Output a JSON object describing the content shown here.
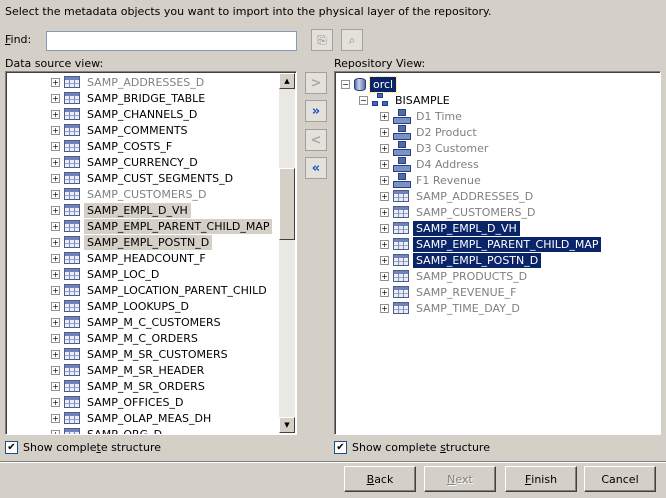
{
  "instruction": "Select the metadata objects you want to import into the physical layer of the repository.",
  "find": {
    "label_prefix": "",
    "label_accel": "F",
    "label_rest": "ind:",
    "value": "",
    "icons": [
      "find-next-icon",
      "find-all-icon"
    ]
  },
  "data_source": {
    "label": "Data source view:",
    "items": [
      {
        "label": "SAMP_ADDRESSES_D",
        "state": "grey"
      },
      {
        "label": "SAMP_BRIDGE_TABLE",
        "state": "normal"
      },
      {
        "label": "SAMP_CHANNELS_D",
        "state": "normal"
      },
      {
        "label": "SAMP_COMMENTS",
        "state": "normal"
      },
      {
        "label": "SAMP_COSTS_F",
        "state": "normal"
      },
      {
        "label": "SAMP_CURRENCY_D",
        "state": "normal"
      },
      {
        "label": "SAMP_CUST_SEGMENTS_D",
        "state": "normal"
      },
      {
        "label": "SAMP_CUSTOMERS_D",
        "state": "grey"
      },
      {
        "label": "SAMP_EMPL_D_VH",
        "state": "selected"
      },
      {
        "label": "SAMP_EMPL_PARENT_CHILD_MAP",
        "state": "selected"
      },
      {
        "label": "SAMP_EMPL_POSTN_D",
        "state": "selected"
      },
      {
        "label": "SAMP_HEADCOUNT_F",
        "state": "normal"
      },
      {
        "label": "SAMP_LOC_D",
        "state": "normal"
      },
      {
        "label": "SAMP_LOCATION_PARENT_CHILD",
        "state": "normal"
      },
      {
        "label": "SAMP_LOOKUPS_D",
        "state": "normal"
      },
      {
        "label": "SAMP_M_C_CUSTOMERS",
        "state": "normal"
      },
      {
        "label": "SAMP_M_C_ORDERS",
        "state": "normal"
      },
      {
        "label": "SAMP_M_SR_CUSTOMERS",
        "state": "normal"
      },
      {
        "label": "SAMP_M_SR_HEADER",
        "state": "normal"
      },
      {
        "label": "SAMP_M_SR_ORDERS",
        "state": "normal"
      },
      {
        "label": "SAMP_OFFICES_D",
        "state": "normal"
      },
      {
        "label": "SAMP_OLAP_MEAS_DH",
        "state": "normal"
      },
      {
        "label": "SAMP_ORG_D",
        "state": "normal"
      }
    ],
    "show_complete_structure": {
      "checked": true,
      "prefix": "Show comple",
      "accel": "t",
      "rest": "e structure"
    }
  },
  "transfer_buttons": [
    {
      "name": "add-selected-button",
      "glyph": ">",
      "enabled": false
    },
    {
      "name": "add-all-button",
      "glyph": "»",
      "enabled": true
    },
    {
      "name": "remove-selected-button",
      "glyph": "<",
      "enabled": false
    },
    {
      "name": "remove-all-button",
      "glyph": "«",
      "enabled": true
    }
  ],
  "repository": {
    "label": "Repository View:",
    "root": {
      "label": "orcl",
      "icon": "database-icon",
      "state": "selected-outline"
    },
    "schema": {
      "label": "BISAMPLE",
      "icon": "schema-icon"
    },
    "items": [
      {
        "label": "D1 Time",
        "icon": "dimension-icon",
        "state": "grey"
      },
      {
        "label": "D2 Product",
        "icon": "dimension-icon",
        "state": "grey"
      },
      {
        "label": "D3 Customer",
        "icon": "dimension-icon",
        "state": "grey"
      },
      {
        "label": "D4 Address",
        "icon": "dimension-icon",
        "state": "grey"
      },
      {
        "label": "F1 Revenue",
        "icon": "dimension-icon",
        "state": "grey"
      },
      {
        "label": "SAMP_ADDRESSES_D",
        "icon": "table-icon",
        "state": "grey"
      },
      {
        "label": "SAMP_CUSTOMERS_D",
        "icon": "table-icon",
        "state": "grey"
      },
      {
        "label": "SAMP_EMPL_D_VH",
        "icon": "table-icon",
        "state": "selected"
      },
      {
        "label": "SAMP_EMPL_PARENT_CHILD_MAP",
        "icon": "table-icon",
        "state": "selected"
      },
      {
        "label": "SAMP_EMPL_POSTN_D",
        "icon": "table-icon",
        "state": "selected"
      },
      {
        "label": "SAMP_PRODUCTS_D",
        "icon": "table-icon",
        "state": "grey"
      },
      {
        "label": "SAMP_REVENUE_F",
        "icon": "table-icon",
        "state": "grey"
      },
      {
        "label": "SAMP_TIME_DAY_D",
        "icon": "table-icon",
        "state": "grey"
      }
    ],
    "show_complete_structure": {
      "checked": true,
      "prefix": "Show complete ",
      "accel": "s",
      "rest": "tructure"
    }
  },
  "buttons": {
    "back": {
      "accel": "B",
      "rest": "ack",
      "enabled": true
    },
    "next": {
      "accel": "N",
      "rest": "ext",
      "enabled": false
    },
    "finish": {
      "accel": "F",
      "rest": "inish",
      "enabled": true
    },
    "cancel": {
      "label": "Cancel",
      "enabled": true
    }
  },
  "colors": {
    "dialog_bg": "#d4d0c8",
    "selection_blue": "#0a246a",
    "selection_grey": "#d4d0c8",
    "active_arrow": "#1a4fc7"
  }
}
